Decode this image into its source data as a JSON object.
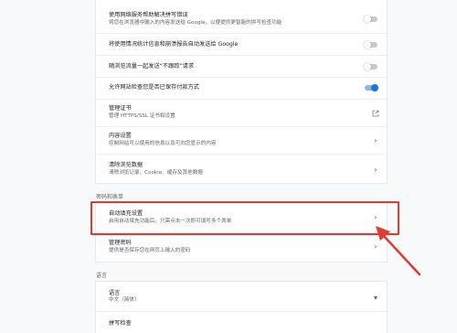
{
  "card1": {
    "rows": [
      {
        "title": "使用网络服务帮助解决拼写错误",
        "subtitle": "将您在浏览器中输入的内容发送给 Google，以便提供更智能的拼写检查功能",
        "control": "toggle",
        "on": false
      },
      {
        "title": "将使用情况统计信息和崩溃报告自动发送给 Google",
        "control": "toggle",
        "on": false
      },
      {
        "title": "随浏览流量一起发送“不跟踪”请求",
        "control": "toggle",
        "on": false
      },
      {
        "title": "允许网站检查您是否已保存付款方式",
        "control": "toggle",
        "on": true
      },
      {
        "title": "管理证书",
        "subtitle": "管理 HTTPS/SSL 证书和设置",
        "control": "external-link-icon"
      },
      {
        "title": "内容设置",
        "subtitle": "控制网站可以使用的信息以及可向您显示的内容",
        "control": "chevron-right-icon"
      },
      {
        "title": "清除浏览数据",
        "subtitle": "清除浏览记录、Cookie、缓存及其他数据",
        "control": "chevron-right-icon"
      }
    ]
  },
  "passwords_section": {
    "label": "密码和表单",
    "rows": [
      {
        "title": "自动填充设置",
        "subtitle": "启用自动填充功能后，只需点击一次即可填写多个表单",
        "control": "chevron-right-icon"
      },
      {
        "title": "管理密码",
        "subtitle": "提供是否保存您在网页上输入的密码",
        "control": "chevron-right-icon"
      }
    ]
  },
  "languages_section": {
    "label": "语言",
    "rows": [
      {
        "title": "语言",
        "subtitle": "中文（简体）",
        "control": "chevron-down-icon"
      },
      {
        "title": "拼写检查",
        "control": "none"
      }
    ]
  },
  "colors": {
    "toggle_on": "#1a73e8",
    "highlight": "#e23a2e"
  }
}
